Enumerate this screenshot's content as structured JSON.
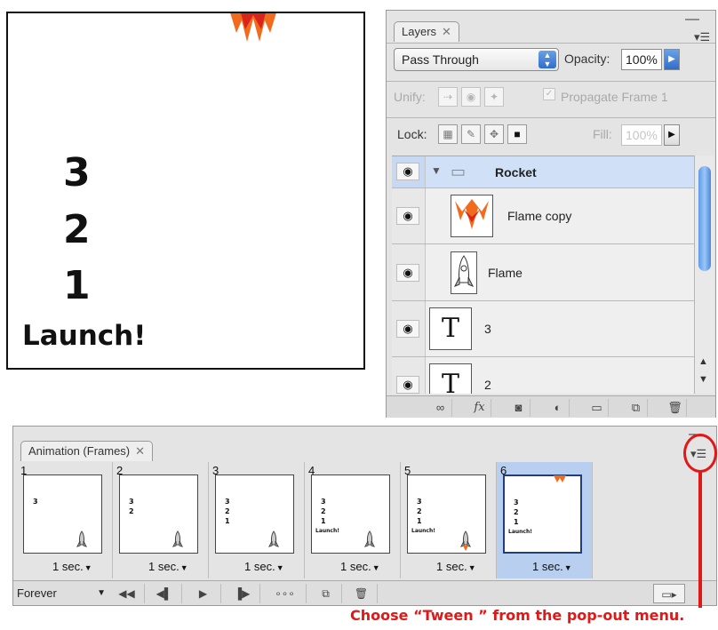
{
  "canvas": {
    "numbers": [
      "3",
      "2",
      "1"
    ],
    "launch_text": "Launch!"
  },
  "layers_panel": {
    "tab_label": "Layers",
    "tab_close": "✕",
    "minimize": "—",
    "menu_icon": "▾☰",
    "blend_mode": "Pass Through",
    "opacity_label": "Opacity:",
    "opacity_value": "100%",
    "unify_label": "Unify:",
    "propagate_label": "Propagate Frame 1",
    "lock_label": "Lock:",
    "fill_label": "Fill:",
    "fill_value": "100%",
    "layers": [
      {
        "name": "Rocket",
        "type": "group",
        "selected": true
      },
      {
        "name": "Flame copy",
        "type": "image"
      },
      {
        "name": "Flame",
        "type": "image"
      },
      {
        "name": "3",
        "type": "text"
      },
      {
        "name": "2",
        "type": "text"
      }
    ],
    "text_thumb_glyph": "T"
  },
  "animation_panel": {
    "tab_label": "Animation (Frames)",
    "tab_close": "✕",
    "minimize": "—",
    "menu_icon": "▾☰",
    "frames": [
      {
        "number": "1",
        "delay": "1 sec."
      },
      {
        "number": "2",
        "delay": "1 sec."
      },
      {
        "number": "3",
        "delay": "1 sec."
      },
      {
        "number": "4",
        "delay": "1 sec."
      },
      {
        "number": "5",
        "delay": "1 sec."
      },
      {
        "number": "6",
        "delay": "1 sec."
      }
    ],
    "loop_option": "Forever"
  },
  "annotation": {
    "text": "Choose “Tween ” from the pop-out menu.",
    "color": "#e01818"
  },
  "colors": {
    "selection_blue": "#cfe0f7",
    "flame_orange": "#f26b1d",
    "flame_red": "#d8241a"
  }
}
